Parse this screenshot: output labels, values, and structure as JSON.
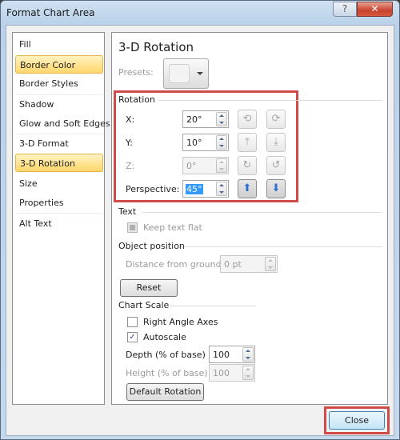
{
  "window": {
    "title": "Format Chart Area",
    "help_label": "?",
    "close_label": "✕"
  },
  "nav": {
    "items": [
      {
        "label": "Fill",
        "state": "normal"
      },
      {
        "label": "Border Color",
        "state": "hover"
      },
      {
        "label": "Border Styles",
        "state": "normal"
      },
      {
        "label": "Shadow",
        "state": "normal"
      },
      {
        "label": "Glow and Soft Edges",
        "state": "normal"
      },
      {
        "label": "3-D Format",
        "state": "normal"
      },
      {
        "label": "3-D Rotation",
        "state": "selected"
      },
      {
        "label": "Size",
        "state": "normal"
      },
      {
        "label": "Properties",
        "state": "normal"
      },
      {
        "label": "Alt Text",
        "state": "normal"
      }
    ]
  },
  "panel": {
    "title": "3-D Rotation",
    "presets_label": "Presets:",
    "rotation": {
      "heading": "Rotation",
      "x": {
        "label": "X:",
        "value": "20°",
        "enabled": true
      },
      "y": {
        "label": "Y:",
        "value": "10°",
        "enabled": true
      },
      "z": {
        "label": "Z:",
        "value": "0°",
        "enabled": false
      },
      "perspective": {
        "label": "Perspective:",
        "value": "45°",
        "enabled": true,
        "selected": true
      },
      "buttons": {
        "x_left": "rotate-left-icon",
        "x_right": "rotate-right-icon",
        "y_up": "rotate-up-icon",
        "y_down": "rotate-down-icon",
        "z_cw": "rotate-clockwise-icon",
        "z_ccw": "rotate-counterclockwise-icon",
        "persp_narrow": "narrow-field-icon",
        "persp_widen": "widen-field-icon"
      }
    },
    "text": {
      "heading": "Text",
      "keep_flat_label": "Keep text flat",
      "keep_flat_checked": false,
      "keep_flat_enabled": false
    },
    "object_position": {
      "heading": "Object position",
      "distance_label": "Distance from ground:",
      "distance_value": "0 pt",
      "reset_label": "Reset"
    },
    "chart_scale": {
      "heading": "Chart Scale",
      "right_angle_label": "Right Angle Axes",
      "right_angle_checked": false,
      "autoscale_label": "Autoscale",
      "autoscale_checked": true,
      "depth_label": "Depth (% of base)",
      "depth_value": "100",
      "height_label": "Height (% of base)",
      "height_value": "100",
      "default_rotation_label": "Default Rotation"
    }
  },
  "footer": {
    "close_label": "Close"
  },
  "colors": {
    "highlight_border": "#d04a48",
    "nav_selected": "#ffd66b",
    "selection": "#3399ff"
  }
}
